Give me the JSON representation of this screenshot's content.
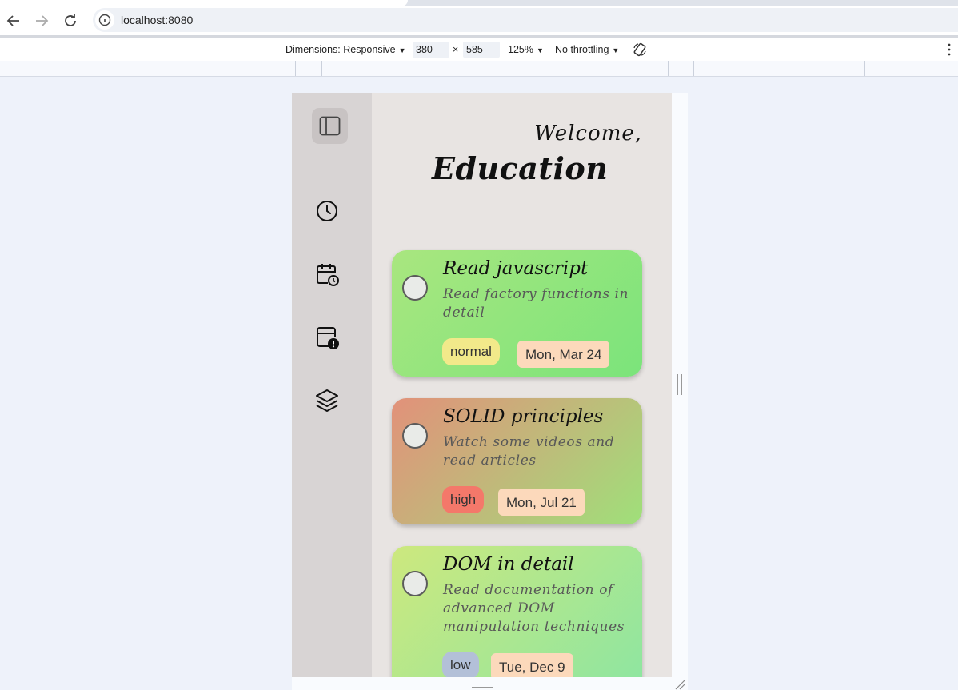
{
  "browser": {
    "url": "localhost:8080"
  },
  "devtools": {
    "dimensions_label": "Dimensions: Responsive",
    "width": "380",
    "times": "×",
    "height": "585",
    "zoom": "125%",
    "throttling": "No throttling"
  },
  "app": {
    "welcome": "Welcome,",
    "project_title": "Education",
    "nav": [
      "sidebar-toggle-icon",
      "clock-icon",
      "calendar-clock-icon",
      "calendar-alert-icon",
      "layers-icon"
    ],
    "tasks": [
      {
        "title": "Read javascript",
        "description": "Read factory functions in detail",
        "priority": "normal",
        "due": "Mon, Mar 24",
        "priority_color": "#f2e98a",
        "gradient": [
          "#a9e67f",
          "#7be47b"
        ]
      },
      {
        "title": "SOLID principles",
        "description": "Watch some videos and read articles",
        "priority": "high",
        "due": "Mon, Jul 21",
        "priority_color": "#f4786a",
        "gradient": [
          "#e2917a",
          "#9fe07a"
        ]
      },
      {
        "title": "DOM in detail",
        "description": "Read documentation of advanced DOM manipulation techniques",
        "priority": "low",
        "due": "Tue, Dec 9",
        "priority_color": "#b3c0d8",
        "gradient": [
          "#cde87e",
          "#8ce6a2"
        ]
      }
    ]
  }
}
